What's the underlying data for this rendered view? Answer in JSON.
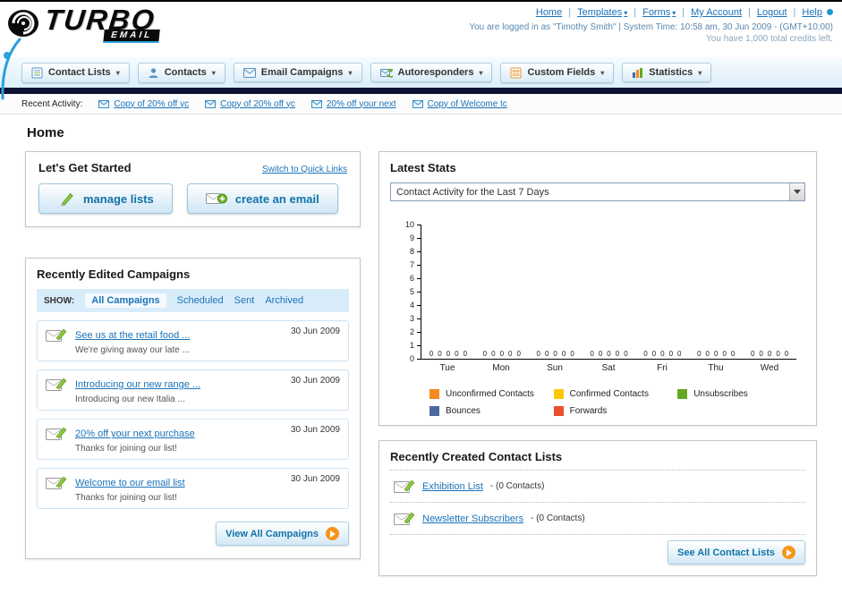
{
  "icons": {
    "dropdown_arrow": "▾"
  },
  "header": {
    "logo_text": "TURBO",
    "logo_sub": "EMAIL",
    "nav_links": [
      "Home",
      "Templates",
      "Forms",
      "My Account",
      "Logout",
      "Help"
    ],
    "login_info": "You are logged in as \"Timothy Smith\" | System Time: 10:58 am, 30 Jun 2009 - (GMT+10:00)",
    "credits_info": "You have 1,000 total credits left."
  },
  "nav": {
    "tabs": [
      {
        "label": "Contact Lists"
      },
      {
        "label": "Contacts"
      },
      {
        "label": "Email Campaigns"
      },
      {
        "label": "Autoresponders"
      },
      {
        "label": "Custom Fields"
      },
      {
        "label": "Statistics"
      }
    ]
  },
  "recent_activity": {
    "label": "Recent Activity:",
    "items": [
      "Copy of 20% off yc",
      "Copy of 20% off yc",
      "20% off your next",
      "Copy of Welcome tc"
    ]
  },
  "page_title": "Home",
  "get_started": {
    "title": "Let's Get Started",
    "switch_link": "Switch to Quick Links",
    "manage_lists_label": "manage lists",
    "create_email_label": "create an email"
  },
  "campaigns": {
    "title": "Recently Edited Campaigns",
    "show_label": "SHOW:",
    "filters": [
      "All Campaigns",
      "Scheduled",
      "Sent",
      "Archived"
    ],
    "items": [
      {
        "title": "See us at the retail food ...",
        "subtitle": "We're giving away our late ...",
        "date": "30 Jun 2009"
      },
      {
        "title": "Introducing our new range ...",
        "subtitle": "Introducing our new Italia ...",
        "date": "30 Jun 2009"
      },
      {
        "title": "20% off your next purchase",
        "subtitle": "Thanks for joining our list!",
        "date": "30 Jun 2009"
      },
      {
        "title": "Welcome to our email list",
        "subtitle": "Thanks for joining our list!",
        "date": "30 Jun 2009"
      }
    ],
    "view_all_label": "View All Campaigns"
  },
  "stats": {
    "title": "Latest Stats",
    "dropdown_value": "Contact Activity for the Last 7 Days",
    "legend": [
      {
        "label": "Unconfirmed Contacts",
        "color": "#f6891f"
      },
      {
        "label": "Confirmed Contacts",
        "color": "#fdc800"
      },
      {
        "label": "Unsubscribes",
        "color": "#66a822"
      },
      {
        "label": "Bounces",
        "color": "#4a68a0"
      },
      {
        "label": "Forwards",
        "color": "#e8502d"
      }
    ]
  },
  "chart_data": {
    "type": "bar",
    "title": "Contact Activity for the Last 7 Days",
    "categories": [
      "Tue",
      "Mon",
      "Sun",
      "Sat",
      "Fri",
      "Thu",
      "Wed"
    ],
    "series": [
      {
        "name": "Unconfirmed Contacts",
        "values": [
          0,
          0,
          0,
          0,
          0,
          0,
          0
        ]
      },
      {
        "name": "Confirmed Contacts",
        "values": [
          0,
          0,
          0,
          0,
          0,
          0,
          0
        ]
      },
      {
        "name": "Unsubscribes",
        "values": [
          0,
          0,
          0,
          0,
          0,
          0,
          0
        ]
      },
      {
        "name": "Bounces",
        "values": [
          0,
          0,
          0,
          0,
          0,
          0,
          0
        ]
      },
      {
        "name": "Forwards",
        "values": [
          0,
          0,
          0,
          0,
          0,
          0,
          0
        ]
      }
    ],
    "xlabel": "",
    "ylabel": "",
    "ylim": [
      0,
      10
    ],
    "yticks": [
      0,
      1,
      2,
      3,
      4,
      5,
      6,
      7,
      8,
      9,
      10
    ],
    "grid": false,
    "legend_position": "bottom"
  },
  "contact_lists": {
    "title": "Recently Created Contact Lists",
    "items": [
      {
        "name": "Exhibition List",
        "suffix": "- (0 Contacts)"
      },
      {
        "name": "Newsletter Subscribers",
        "suffix": "- (0 Contacts)"
      }
    ],
    "see_all_label": "See All Contact Lists"
  }
}
